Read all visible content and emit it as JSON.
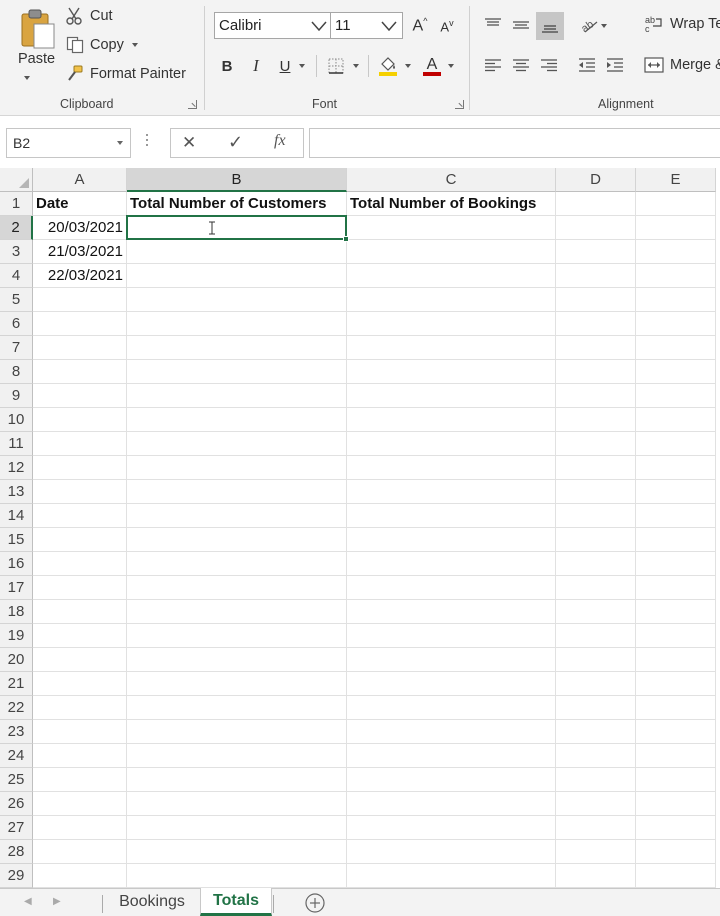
{
  "ribbon": {
    "clipboard": {
      "paste_label": "Paste",
      "cut_label": "Cut",
      "copy_label": "Copy",
      "format_painter_label": "Format Painter",
      "group_label": "Clipboard"
    },
    "font": {
      "font_name": "Calibri",
      "font_size": "11",
      "bold_label": "B",
      "italic_label": "I",
      "underline_label": "U",
      "font_color_label": "A",
      "group_label": "Font"
    },
    "alignment": {
      "wrap_text_label": "Wrap Text",
      "merge_label": "Merge & Center",
      "group_label": "Alignment"
    }
  },
  "formula_bar": {
    "name_box": "B2",
    "cancel_label": "✕",
    "enter_label": "✓",
    "function_label": "fx",
    "formula": ""
  },
  "grid": {
    "columns": [
      "A",
      "B",
      "C",
      "D",
      "E"
    ],
    "rows": [
      "1",
      "2",
      "3",
      "4",
      "5",
      "6",
      "7",
      "8",
      "9",
      "10",
      "11",
      "12",
      "13",
      "14",
      "15",
      "16",
      "17",
      "18",
      "19",
      "20",
      "21",
      "22",
      "23",
      "24",
      "25",
      "26",
      "27",
      "28",
      "29"
    ],
    "selected_cell": "B2",
    "cells": {
      "A1": "Date",
      "B1": "Total Number of Customers",
      "C1": "Total Number of Bookings",
      "A2": "20/03/2021",
      "A3": "21/03/2021",
      "A4": "22/03/2021"
    }
  },
  "sheets": {
    "tabs": [
      "Bookings",
      "Totals"
    ],
    "active": "Totals"
  },
  "colors": {
    "accent": "#217346",
    "ribbon_bg": "#f3f3f3",
    "header_bg": "#f1f1f1",
    "highlight_yellow": "#f5d000",
    "font_color_red": "#c00000"
  }
}
